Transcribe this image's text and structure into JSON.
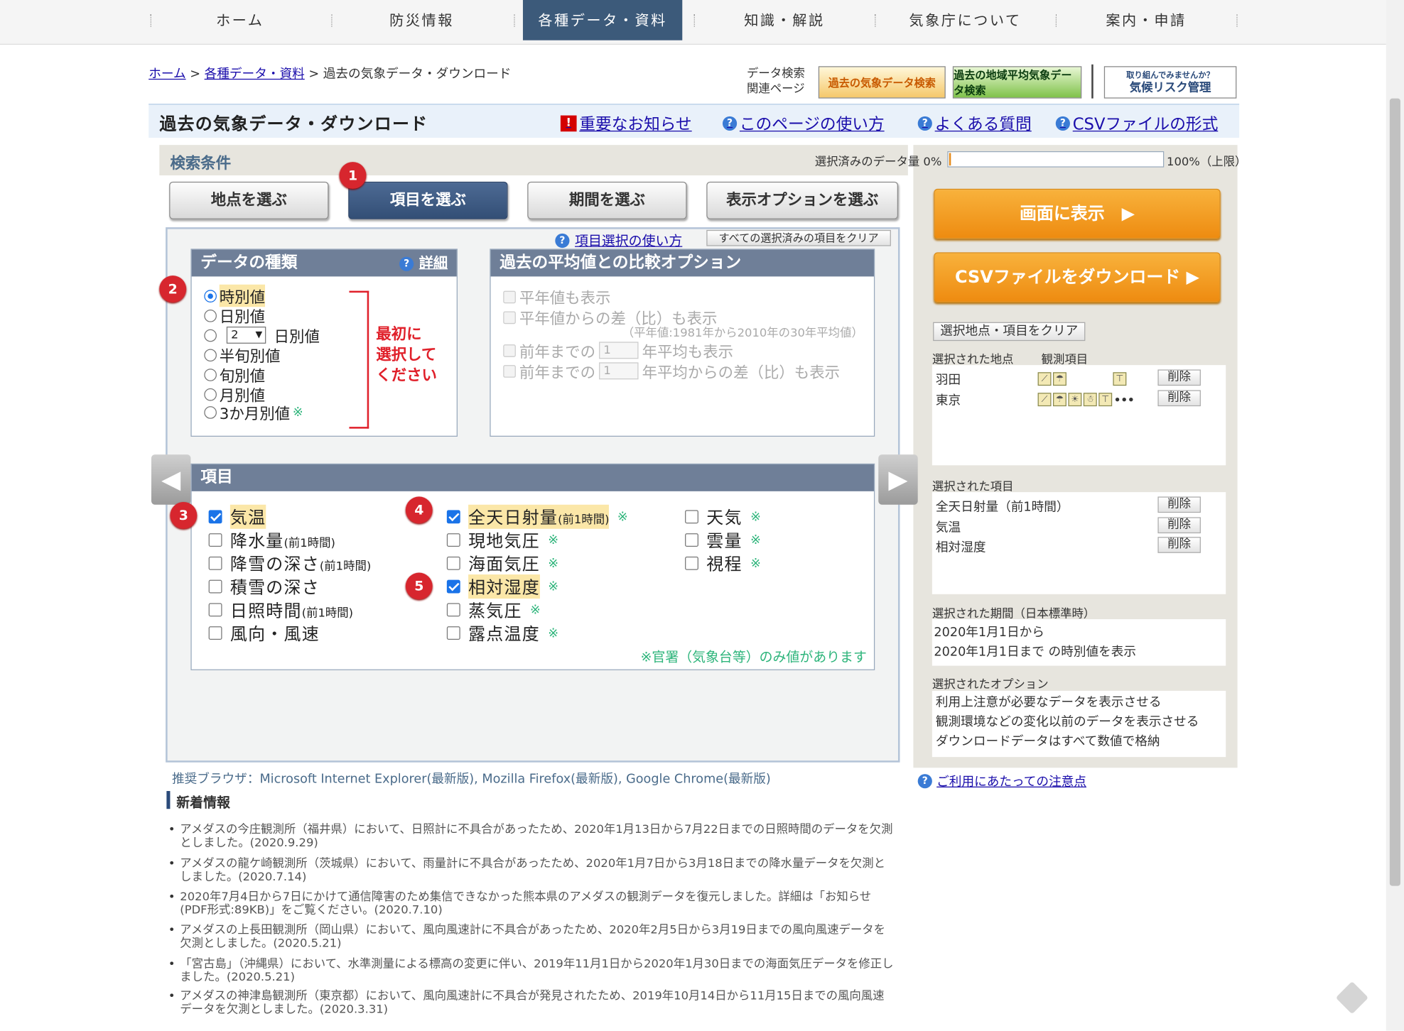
{
  "nav": {
    "items": [
      "ホーム",
      "防災情報",
      "各種データ・資料",
      "知識・解説",
      "気象庁について",
      "案内・申請"
    ],
    "active_index": 2
  },
  "breadcrumb": {
    "home": "ホーム",
    "sep": ">",
    "data": "各種データ・資料",
    "current": "過去の気象データ・ダウンロード"
  },
  "related": {
    "label_line1": "データ検索",
    "label_line2": "関連ページ",
    "banner1": "過去の気象データ検索",
    "banner2": "過去の地域平均気象データ検索",
    "banner3_small": "取り組んでみませんか？",
    "banner3": "気候リスク管理"
  },
  "title": {
    "text": "過去の気象データ・ダウンロード",
    "link_notice": "重要なお知らせ",
    "link_howto": "このページの使い方",
    "link_faq": "よくある質問",
    "link_csv": "CSVファイルの形式"
  },
  "search": {
    "label": "検索条件",
    "amount_label": "選択済みのデータ量 0%",
    "amount_max": "100%（上限）",
    "amount_fraction": 0.01,
    "steps": [
      "地点を選ぶ",
      "項目を選ぶ",
      "期間を選ぶ",
      "表示オプションを選ぶ"
    ],
    "active_step": 1,
    "howto_link": "項目選択の使い方",
    "clear_all": "すべての選択済みの項目をクリア"
  },
  "badges": [
    "1",
    "2",
    "3",
    "4",
    "5"
  ],
  "datatype": {
    "header": "データの種類",
    "detail_link": "詳細",
    "options": [
      "時別値",
      "日別値",
      "日別値",
      "半旬別値",
      "旬別値",
      "月別値",
      "3か月別値"
    ],
    "selected_index": 0,
    "n_days_value": "2",
    "note_mark": "※",
    "annotation": "最初に選択してください",
    "annotation_lines": [
      "最初に",
      "選択して",
      "ください"
    ],
    "annotation_color": "#e0202a"
  },
  "compare": {
    "header": "過去の平均値との比較オプション",
    "opt1": "平年値も表示",
    "opt2": "平年値からの差（比）も表示",
    "note": "（平年値:1981年から2010年の30年平均値）",
    "opt3_pre": "前年までの",
    "opt3_val": "1",
    "opt3_post": "年平均も表示",
    "opt4_pre": "前年までの",
    "opt4_val": "1",
    "opt4_post": "年平均からの差（比）も表示"
  },
  "items": {
    "header": "項目",
    "col1": [
      {
        "label": "気温",
        "sub": "",
        "checked": true,
        "highlight": true,
        "note": ""
      },
      {
        "label": "降水量",
        "sub": "(前1時間)",
        "checked": false,
        "highlight": false,
        "note": ""
      },
      {
        "label": "降雪の深さ",
        "sub": "(前1時間)",
        "checked": false,
        "highlight": false,
        "note": ""
      },
      {
        "label": "積雪の深さ",
        "sub": "",
        "checked": false,
        "highlight": false,
        "note": ""
      },
      {
        "label": "日照時間",
        "sub": "(前1時間)",
        "checked": false,
        "highlight": false,
        "note": ""
      },
      {
        "label": "風向・風速",
        "sub": "",
        "checked": false,
        "highlight": false,
        "note": ""
      }
    ],
    "col2": [
      {
        "label": "全天日射量",
        "sub": "(前1時間)",
        "checked": true,
        "highlight": true,
        "note": "※"
      },
      {
        "label": "現地気圧",
        "sub": "",
        "checked": false,
        "highlight": false,
        "note": "※"
      },
      {
        "label": "海面気圧",
        "sub": "",
        "checked": false,
        "highlight": false,
        "note": "※"
      },
      {
        "label": "相対湿度",
        "sub": "",
        "checked": true,
        "highlight": true,
        "note": "※"
      },
      {
        "label": "蒸気圧",
        "sub": "",
        "checked": false,
        "highlight": false,
        "note": "※"
      },
      {
        "label": "露点温度",
        "sub": "",
        "checked": false,
        "highlight": false,
        "note": "※"
      }
    ],
    "col3": [
      {
        "label": "天気",
        "sub": "",
        "checked": false,
        "highlight": false,
        "note": "※"
      },
      {
        "label": "雲量",
        "sub": "",
        "checked": false,
        "highlight": false,
        "note": "※"
      },
      {
        "label": "視程",
        "sub": "",
        "checked": false,
        "highlight": false,
        "note": "※"
      }
    ],
    "footnote": "※官署（気象台等）のみ値があります"
  },
  "right": {
    "show_btn": "画面に表示　▶",
    "csv_btn": "CSVファイルをダウンロード ▶",
    "clear_btn": "選択地点・項目をクリア",
    "stations_label": "選択された地点",
    "obs_label": "観測項目",
    "stations": [
      {
        "name": "羽田",
        "icons": "rain-wind-icons",
        "delete": "削除"
      },
      {
        "name": "東京",
        "icons": "rain-sun-snow-wind-icons",
        "delete": "削除"
      }
    ],
    "items_label": "選択された項目",
    "selected_items": [
      {
        "name": "全天日射量（前1時間）",
        "delete": "削除"
      },
      {
        "name": "気温",
        "delete": "削除"
      },
      {
        "name": "相対湿度",
        "delete": "削除"
      }
    ],
    "period_label": "選択された期間（日本標準時）",
    "period_line1": "2020年1月1日から",
    "period_line2": "2020年1月1日まで の時別値を表示",
    "options_label": "選択されたオプション",
    "options": [
      "利用上注意が必要なデータを表示させる",
      "観測環境などの変化以前のデータを表示させる",
      "ダウンロードデータはすべて数値で格納"
    ],
    "notice_link": "ご利用にあたっての注意点"
  },
  "browser_note": "推奨ブラウザ：Microsoft Internet Explorer(最新版), Mozilla Firefox(最新版), Google Chrome(最新版)",
  "news": {
    "header": "新着情報",
    "items": [
      "アメダスの今庄観測所（福井県）において、日照計に不具合があったため、2020年1月13日から7月22日までの日照時間のデータを欠測としました。(2020.9.29)",
      "アメダスの龍ケ崎観測所（茨城県）において、雨量計に不具合があったため、2020年1月7日から3月18日までの降水量データを欠測としました。(2020.7.14)",
      "2020年7月4日から7日にかけて通信障害のため集信できなかった熊本県のアメダスの観測データを復元しました。詳細は「お知らせ(PDF形式:89KB)」をご覧ください。(2020.7.10)",
      "アメダスの上長田観測所（岡山県）において、風向風速計に不具合があったため、2020年2月5日から3月19日までの風向風速データを欠測としました。(2020.5.21)",
      "「宮古島」（沖縄県）において、水準測量による標高の変更に伴い、2019年11月1日から2020年1月30日までの海面気圧データを修正しました。(2020.5.21)",
      "アメダスの神津島観測所（東京都）において、風向風速計に不具合が発見されたため、2019年10月14日から11月15日までの風向風速データを欠測としました。(2020.3.31)"
    ]
  }
}
